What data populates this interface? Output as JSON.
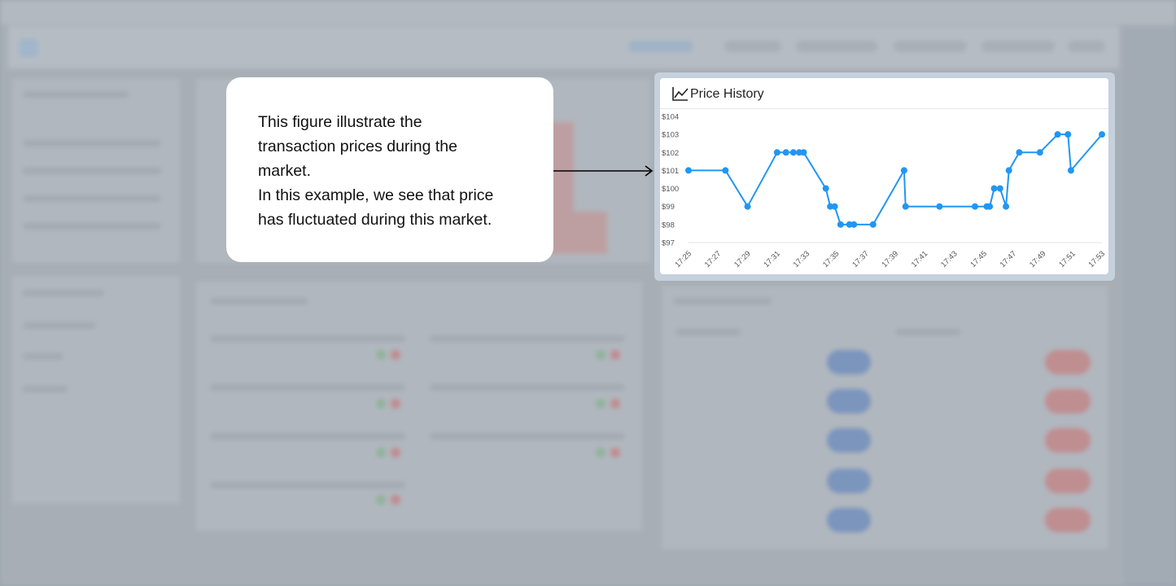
{
  "callout": {
    "lines": [
      "This figure illustrate the",
      "transaction prices during the",
      "market.",
      "In this example, we see that price",
      "has fluctuated during this market."
    ]
  },
  "card": {
    "title": "Price History",
    "icon": "line-chart-icon"
  },
  "colors": {
    "line": "#2196f3",
    "highlight": "#c5d1dc"
  },
  "chart_data": {
    "type": "line",
    "title": "Price History",
    "xlabel": "",
    "ylabel": "",
    "ylim": [
      97,
      104
    ],
    "y_ticks": [
      "$97",
      "$98",
      "$99",
      "$100",
      "$101",
      "$102",
      "$103",
      "$104"
    ],
    "x_ticks": [
      "17:25",
      "17:27",
      "17:29",
      "17:31",
      "17:33",
      "17:35",
      "17:37",
      "17:39",
      "17:41",
      "17:43",
      "17:45",
      "17:47",
      "17:49",
      "17:51",
      "17:53"
    ],
    "x_tick_minutes": [
      25,
      27,
      29,
      31,
      33,
      35,
      37,
      39,
      41,
      43,
      45,
      47,
      49,
      51,
      53
    ],
    "grid": false,
    "series": [
      {
        "x": [
          25.0,
          27.5,
          29.0,
          31.0,
          31.6,
          32.1,
          32.5,
          32.8,
          34.3,
          34.6,
          34.9,
          35.3,
          35.9,
          36.2,
          37.5,
          39.6,
          39.7,
          42.0,
          44.4,
          45.2,
          45.4,
          45.7,
          46.1,
          46.5,
          46.7,
          47.4,
          48.8,
          50.0,
          50.7,
          50.9,
          53.0
        ],
        "y": [
          101,
          101,
          99,
          102,
          102,
          102,
          102,
          102,
          100,
          99,
          99,
          98,
          98,
          98,
          98,
          101,
          99,
          99,
          99,
          99,
          99,
          100,
          100,
          99,
          101,
          102,
          102,
          103,
          103,
          101,
          103
        ]
      }
    ]
  }
}
